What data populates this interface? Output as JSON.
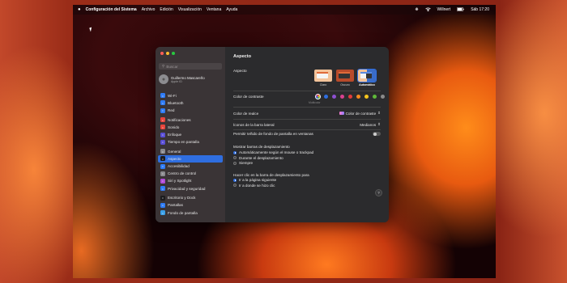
{
  "menubar": {
    "apple": "",
    "app_name": "Configuración del Sistema",
    "menus": [
      "Archivo",
      "Edición",
      "Visualización",
      "Ventana",
      "Ayuda"
    ],
    "status": {
      "user": "Willnert",
      "datetime": "Sáb 17:20"
    }
  },
  "sidebar": {
    "search_placeholder": "Buscar",
    "profile": {
      "name": "Guillermo Mascareño",
      "sub": "Apple ID"
    },
    "items": [
      {
        "label": "Wi-Fi",
        "color": "#2f7cf6",
        "icon": "wifi-icon"
      },
      {
        "label": "Bluetooth",
        "color": "#2f7cf6",
        "icon": "bluetooth-icon"
      },
      {
        "label": "Red",
        "color": "#2f7cf6",
        "icon": "globe-icon"
      },
      {
        "label": "Notificaciones",
        "color": "#e8453c",
        "icon": "bell-icon"
      },
      {
        "label": "Sonido",
        "color": "#e8453c",
        "icon": "speaker-icon"
      },
      {
        "label": "Enfoque",
        "color": "#5a4fd6",
        "icon": "moon-icon"
      },
      {
        "label": "Tiempo en pantalla",
        "color": "#5a4fd6",
        "icon": "hourglass-icon"
      },
      {
        "label": "General",
        "color": "#8a8a8e",
        "icon": "gear-icon"
      },
      {
        "label": "Aspecto",
        "color": "#1c1c1e",
        "icon": "appearance-icon"
      },
      {
        "label": "Accesibilidad",
        "color": "#2f7cf6",
        "icon": "accessibility-icon"
      },
      {
        "label": "Centro de control",
        "color": "#8a8a8e",
        "icon": "control-center-icon"
      },
      {
        "label": "Siri y Spotlight",
        "color": "#b04ad6",
        "icon": "siri-icon"
      },
      {
        "label": "Privacidad y seguridad",
        "color": "#2f7cf6",
        "icon": "hand-icon"
      },
      {
        "label": "Escritorio y Dock",
        "color": "#1c1c1e",
        "icon": "dock-icon"
      },
      {
        "label": "Pantallas",
        "color": "#2f7cf6",
        "icon": "display-icon"
      },
      {
        "label": "Fondo de pantalla",
        "color": "#3aa0e8",
        "icon": "wallpaper-icon"
      }
    ],
    "selected_index": 8
  },
  "main": {
    "title": "Aspecto",
    "appearance": {
      "label": "Aspecto",
      "options": [
        "Claro",
        "Oscuro",
        "Automático"
      ],
      "selected": "Automático"
    },
    "contrast_color": {
      "label": "Color de contraste",
      "colors": [
        "#7a7a7e",
        "#2f6ee0",
        "#8d4fd0",
        "#d8418f",
        "#e23b3b",
        "#f28a1f",
        "#f5c51e",
        "#5fb83a",
        "#8a8a8a"
      ],
      "selected_index": 0,
      "caption": "Multicolor"
    },
    "highlight_color": {
      "label": "Color de realce",
      "value": "Color de contraste"
    },
    "sidebar_icons": {
      "label": "Íconos de la barra lateral",
      "value": "Medianos"
    },
    "wallpaper_tint": {
      "label": "Permitir teñido de fondo de pantalla en ventanas",
      "enabled": false
    },
    "scrollbars": {
      "label": "Mostrar barras de desplazamiento",
      "options": [
        "Automáticamente según el mouse o trackpad",
        "Durante el desplazamiento",
        "Siempre"
      ],
      "selected_index": 0
    },
    "click_scrollbar": {
      "label": "Hacer clic en la barra de desplazamiento para",
      "options": [
        "Ir a la página siguiente",
        "Ir a donde se hizo clic"
      ],
      "selected_index": 0
    },
    "help": "?"
  }
}
